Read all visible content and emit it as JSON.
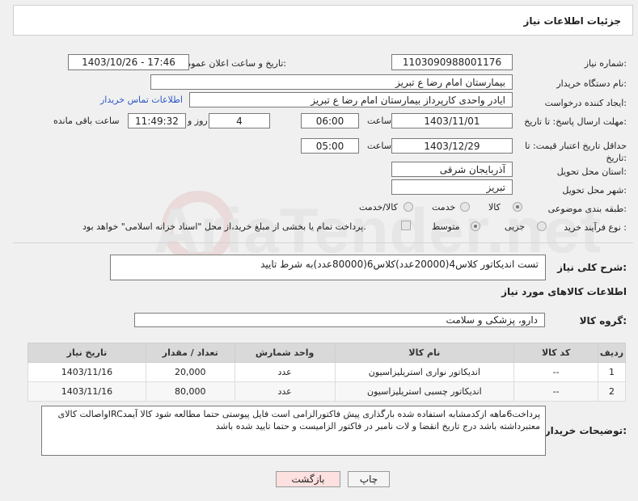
{
  "header": {
    "title": "جزئیات اطلاعات نیاز"
  },
  "watermark": {
    "text": "AriaTender.net"
  },
  "fields": {
    "need_number_label": "شماره نیاز:",
    "need_number": "1103090988001176",
    "announce_label": "تاریخ و ساعت اعلان عمومی:",
    "announce_value": "1403/10/26 - 17:46",
    "buyer_org_label": "نام دستگاه خریدار:",
    "buyer_org": "بیمارستان امام رضا  ع  تبریز",
    "creator_label": "ایجاد کننده درخواست:",
    "creator": "ایادر واحدی کارپرداز بیمارستان امام رضا  ع  تبریز",
    "contact_link": "اطلاعات تماس خریدار",
    "reply_deadline_label": "مهلت ارسال پاسخ: تا تاریخ:",
    "reply_date": "1403/11/01",
    "time_label": "ساعت",
    "reply_time": "06:00",
    "days_value": "4",
    "days_label": "روز و",
    "remaining_time": "11:49:32",
    "remaining_label": "ساعت باقی مانده",
    "price_validity_label": "حداقل تاریخ اعتبار قیمت: تا تاریخ:",
    "price_date": "1403/12/29",
    "price_time": "05:00",
    "province_label": "استان محل تحویل:",
    "province": "آذربایجان شرقی",
    "city_label": "شهر محل تحویل:",
    "city": "تبریز",
    "category_label": "طبقه بندی موضوعی:",
    "category_options": [
      "کالا",
      "خدمت",
      "کالا/خدمت"
    ],
    "process_label": "نوع فرآیند خرید :",
    "process_options": [
      "جزیی",
      "متوسط"
    ],
    "payment_note": "پرداخت تمام یا بخشی از مبلغ خرید،از محل \"اسناد خزانه اسلامی\" خواهد بود.",
    "summary_label": "شرح کلی نیاز:",
    "summary": "تست اندیکاتور کلاس4(20000عدد)کلاس6(80000عدد)به شرط تایید",
    "goods_info_title": "اطلاعات کالاهای مورد نیاز",
    "goods_group_label": "گروه کالا:",
    "goods_group": "دارو، پزشکی و سلامت"
  },
  "table": {
    "headers": [
      "ردیف",
      "کد کالا",
      "نام کالا",
      "واحد شمارش",
      "تعداد / مقدار",
      "تاریخ نیاز"
    ],
    "rows": [
      [
        "1",
        "--",
        "اندیکاتور نواری استریلیزاسیون",
        "عدد",
        "20,000",
        "1403/11/16"
      ],
      [
        "2",
        "--",
        "اندیکاتور چسبی استریلیزاسیون",
        "عدد",
        "80,000",
        "1403/11/16"
      ]
    ]
  },
  "buyer_notes": {
    "label": "توضیحات خریدار:",
    "text": "پرداخت6ماهه ازکدمشابه استفاده شده بارگذاری پیش فاکتورالزامی است فایل پیوستی حتما مطالعه شود کالا آیمدIRCواصالت کالای معتبرداشته باشد درج تاریخ انقضا و لات نامبر در فاکتور الزامیست و حتما  تایید شده باشد"
  },
  "buttons": {
    "print": "چاپ",
    "back": "بازگشت"
  },
  "colors": {
    "link": "#2a56c6",
    "back_button_bg": "#fde0e0",
    "print_button_bg": "#f4f4f4"
  }
}
